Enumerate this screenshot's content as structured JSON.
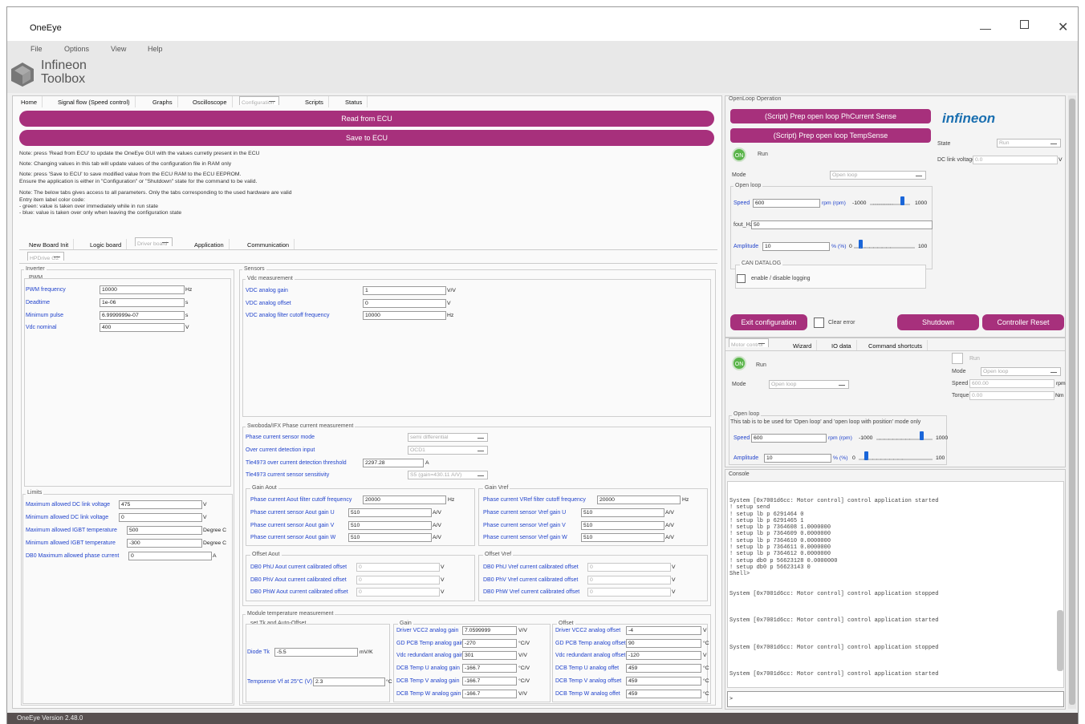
{
  "app": {
    "title": "OneEye",
    "logo_line1": "Infineon",
    "logo_line2": "Toolbox",
    "version": "OneEye Version 2.48.0"
  },
  "menu": [
    "File",
    "Options",
    "View",
    "Help"
  ],
  "main_tabs": [
    "Home",
    "Signal flow (Speed control)",
    "Graphs",
    "Oscilloscope",
    "Configuration",
    "Scripts",
    "Status"
  ],
  "buttons": {
    "read": "Read from ECU",
    "save": "Save to ECU"
  },
  "notes": [
    "Note: press 'Read from ECU' to update the OneEye GUI with the values curretly present in the ECU",
    "Note: Changing values in this tab will update values of the configuration file in RAM only",
    "Note: press 'Save to ECU' to save modified value from the ECU RAM to the ECU EEPROM.",
    "Ensure the application is either in \"Configuration\" or \"Shutdown\" state for the command to be valid.",
    "Note: The below tabs gives access to all parameters. Only the tabs corresponding to the used hardware are valid",
    "Entry item label color code:",
    "- green: value is taken over immediately while in run state",
    "- blue: value is taken over only when leaving the configuration state"
  ],
  "sub_tabs": [
    "New Board Init",
    "Logic board",
    "Driver board",
    "Application",
    "Communication"
  ],
  "driver_tab": "HPDrive G2",
  "inverter": {
    "title": "Inverter",
    "pwm_title": "PWM",
    "rows": [
      {
        "label": "PWM frequency",
        "value": "10000",
        "unit": "Hz"
      },
      {
        "label": "Deadtime",
        "value": "1e-06",
        "unit": "s"
      },
      {
        "label": "Minimum pulse",
        "value": "6.9999999e-07",
        "unit": "s"
      },
      {
        "label": "Vdc nominal",
        "value": "400",
        "unit": "V"
      }
    ]
  },
  "limits": {
    "title": "Limits",
    "rows": [
      {
        "label": "Maximum allowed DC link voltage",
        "value": "475",
        "unit": "V"
      },
      {
        "label": "Minimum allowed DC link voltage",
        "value": "0",
        "unit": "V"
      },
      {
        "label": "Maximum allowed IGBT temperature",
        "value": "500",
        "unit": "Degree C"
      },
      {
        "label": "Minimum allowed IGBT temperature",
        "value": "-300",
        "unit": "Degree C"
      },
      {
        "label": "DB0 Maximum allowed phase current",
        "value": "0",
        "unit": "A"
      }
    ]
  },
  "sensors": {
    "title": "Sensors",
    "vdc_title": "Vdc measurement",
    "vdc": [
      {
        "label": "VDC analog gain",
        "value": "1",
        "unit": "V/V"
      },
      {
        "label": "VDC analog offset",
        "value": "0",
        "unit": "V"
      },
      {
        "label": "VDC analog filter cutoff frequency",
        "value": "10000",
        "unit": "Hz"
      }
    ]
  },
  "phase": {
    "title": "Swoboda/IFX Phase current measurement",
    "mode_label": "Phase current sensor mode",
    "mode_value": "semi differential",
    "ocd_label": "Over current detection input",
    "ocd_value": "OCD1",
    "thr_label": "Tle4973 over current detection threshold",
    "thr_value": "2297.28",
    "thr_unit": "A",
    "sens_label": "Tle4973 current sensor sensitivity",
    "sens_value": "S5 (gain=430.11 A/V)",
    "gain_aout_title": "Gain Aout",
    "gain_aout": [
      {
        "label": "Phase current Aout filter cutoff frequency",
        "value": "20000",
        "unit": "Hz"
      },
      {
        "label": "Phase current sensor Aout gain U",
        "value": "510",
        "unit": "A/V"
      },
      {
        "label": "Phase current sensor Aout gain V",
        "value": "510",
        "unit": "A/V"
      },
      {
        "label": "Phase current sensor Aout gain W",
        "value": "510",
        "unit": "A/V"
      }
    ],
    "gain_vref_title": "Gain Vref",
    "gain_vref": [
      {
        "label": "Phase current VRef filter cutoff frequency",
        "value": "20000",
        "unit": "Hz"
      },
      {
        "label": "Phase current sensor Vref gain U",
        "value": "510",
        "unit": "A/V"
      },
      {
        "label": "Phase current sensor Vref gain V",
        "value": "510",
        "unit": "A/V"
      },
      {
        "label": "Phase current sensor Vref gain W",
        "value": "510",
        "unit": "A/V"
      }
    ],
    "off_aout_title": "Offset Aout",
    "off_aout": [
      {
        "label": "DB0 PhU Aout current calibrated offset",
        "value": "0",
        "unit": "V"
      },
      {
        "label": "DB0 PhV Aout current calibrated offset",
        "value": "0",
        "unit": "V"
      },
      {
        "label": "DB0 PhW Aout current calibrated offset",
        "value": "0",
        "unit": "V"
      }
    ],
    "off_vref_title": "Offset Vref",
    "off_vref": [
      {
        "label": "DB0 PhU Vref current calibrated offset",
        "value": "0",
        "unit": "V"
      },
      {
        "label": "DB0 PhV Vref current calibrated offset",
        "value": "0",
        "unit": "V"
      },
      {
        "label": "DB0 PhW Vref current calibrated offset",
        "value": "0",
        "unit": "V"
      }
    ]
  },
  "temp": {
    "title": "Module temperature measurement",
    "tk_title": "set Tk and Auto-Offset",
    "diode_label": "Diode Tk",
    "diode_value": "-5.5",
    "diode_unit": "mV/K",
    "vf_label": "Tempsense Vf at 25°C (V)",
    "vf_value": "2.3",
    "vf_unit": "°C",
    "gain_title": "Gain",
    "gain": [
      {
        "label": "Driver VCC2 analog gain",
        "value": "7.0599999",
        "unit": "V/V"
      },
      {
        "label": "GD PCB Temp analog gain",
        "value": "-270",
        "unit": "°C/V"
      },
      {
        "label": "Vdc redundant analog gain",
        "value": "301",
        "unit": "V/V"
      },
      {
        "label": "DCB Temp U analog gain",
        "value": "-166.7",
        "unit": "°C/V"
      },
      {
        "label": "DCB Temp V analog gain",
        "value": "-166.7",
        "unit": "°C/V"
      },
      {
        "label": "DCB Temp W analog gain",
        "value": "-166.7",
        "unit": "V/V"
      }
    ],
    "offset_title": "Offset",
    "offset": [
      {
        "label": "Driver VCC2 analog offset",
        "value": "-4",
        "unit": "V"
      },
      {
        "label": "GD PCB Temp analog offset",
        "value": "90",
        "unit": "°C"
      },
      {
        "label": "Vdc redundant analog offset",
        "value": "-120",
        "unit": "V"
      },
      {
        "label": "DCB Temp U analog offet",
        "value": "459",
        "unit": "°C"
      },
      {
        "label": "DCB Temp V analog offset",
        "value": "459",
        "unit": "°C"
      },
      {
        "label": "DCB Temp W analog offet",
        "value": "459",
        "unit": "°C"
      }
    ]
  },
  "openloop": {
    "title": "OpenLoop Operation",
    "btn1": "(Script) Prep open loop PhCurrent Sense",
    "btn2": "(Script) Prep open loop TempSense",
    "brand": "infineon",
    "state_label": "State",
    "state_value": "Run",
    "dclink_label": "DC link voltage",
    "dclink_value": "0.0",
    "unit_v": "V",
    "on": "ON",
    "run": "Run",
    "mode_label": "Mode",
    "mode_value": "Open loop",
    "ol_title": "Open loop",
    "speed_label": "Speed",
    "speed_value": "600",
    "speed_unit": "rpm (rpm)",
    "speed_min": "-1000",
    "speed_max": "1000",
    "fout_label": "fout_Hz",
    "fout_value": "50",
    "amp_label": "Amplitude",
    "amp_value": "10",
    "amp_unit": "% (%)",
    "amp_min": "0",
    "amp_max": "100",
    "can_title": "CAN DATALOG",
    "can_label": "enable / disable logging"
  },
  "actions": {
    "exit": "Exit configuration",
    "clear": "Clear error",
    "shutdown": "Shutdown",
    "reset": "Controller Reset"
  },
  "motor_tabs": [
    "Motor control",
    "Wizard",
    "IO data",
    "Command shortcuts"
  ],
  "motor": {
    "on": "ON",
    "run": "Run",
    "mode_label": "Mode",
    "mode_value": "Open loop",
    "run2": "Run",
    "mode2_label": "Mode",
    "mode2_value": "Open loop",
    "speed_label": "Speed",
    "speed_value": "600.00",
    "speed_unit": "rpm",
    "torque_label": "Torque",
    "torque_value": "0.00",
    "torque_unit": "Nm",
    "ol_title": "Open loop",
    "ol_desc": "This tab is to be used for 'Open loop' and 'open loop with position' mode only",
    "s_label": "Speed",
    "s_value": "600",
    "s_unit": "rpm (rpm)",
    "s_min": "-1000",
    "s_max": "1000",
    "a_label": "Amplitude",
    "a_value": "10",
    "a_unit": "% (%)",
    "a_min": "0",
    "a_max": "100"
  },
  "console": {
    "title": "Console",
    "lines": [
      "System [0x7001d6cc: Motor control] control application started",
      "! setup send",
      "! setup lb p 6291464 0",
      "! setup lb p 6291465 1",
      "! setup lb p 7364608 1.0000000",
      "! setup lb p 7364609 0.0000000",
      "! setup lb p 7364610 0.0000000",
      "! setup lb p 7364611 0.0000000",
      "! setup lb p 7364612 0.0000000",
      "! setup db0 p 56623128 0.0000000",
      "! setup db0 p 56623143 0",
      "Shell>",
      "",
      "",
      "System [0x7001d6cc: Motor control] control application stopped",
      "",
      "",
      "",
      "System [0x7001d6cc: Motor control] control application started",
      "",
      "",
      "",
      "System [0x7001d6cc: Motor control] control application stopped",
      "",
      "",
      "",
      "System [0x7001d6cc: Motor control] control application started"
    ],
    "prompt": ">"
  }
}
